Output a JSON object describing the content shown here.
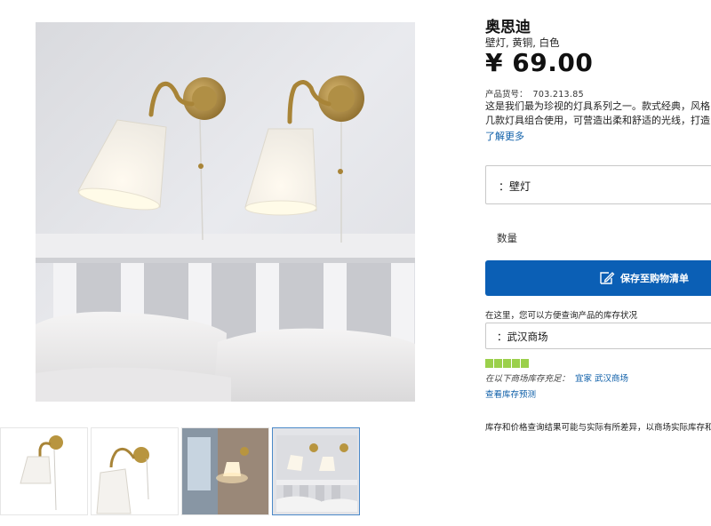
{
  "product": {
    "name": "奥思迪",
    "subtitle": "壁灯, 黄铜, 白色",
    "price": "¥ 69.00",
    "article_label": "产品货号：",
    "article_number": "703.213.85",
    "description_line1": "这是我们最为珍视的灯具系列之一。款式经典，风格",
    "description_line2": "几款灯具组合使用，可营造出柔和舒适的光线，打造",
    "read_more": "了解更多"
  },
  "selectors": {
    "type_value": "：壁灯",
    "quantity_label": "数量",
    "save_button_label": "保存至购物清单"
  },
  "store": {
    "check_text": "在这里，您可以方便查询产品的库存状况",
    "selected_store": "：武汉商场",
    "stock_levels": 5,
    "stock_color": "#9bd04b",
    "stock_label": "在以下商场库存充足：",
    "stock_store_link": "宜家 武汉商场",
    "forecast_link": "查看库存预测",
    "disclaimer": "库存和价格查询结果可能与实际有所差异，以商场实际库存和"
  },
  "gallery": {
    "icon_main": "product-photo-two-wall-lamps",
    "thumbnails": [
      "lamp-white-background",
      "lamp-side-view",
      "lamp-in-room",
      "two-lamps-over-bed"
    ],
    "selected_index": 3
  },
  "colors": {
    "accent": "#0b5fb5",
    "link": "#0c5ea8",
    "stock_green": "#9bd04b"
  }
}
